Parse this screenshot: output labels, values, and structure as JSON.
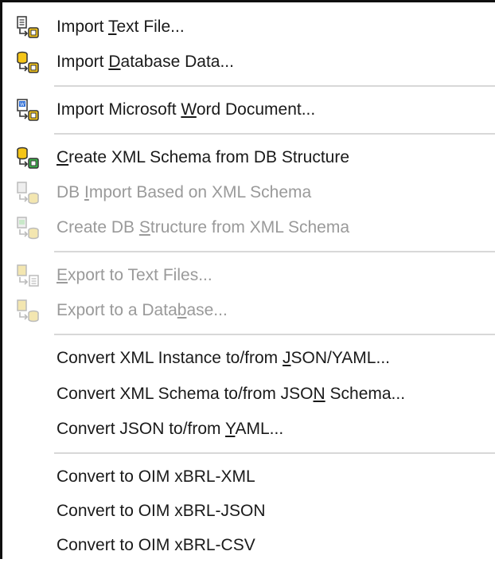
{
  "menu": {
    "items": [
      {
        "pre": "Import ",
        "key": "T",
        "post": "ext File...",
        "icon": "import-text-file-icon"
      },
      {
        "pre": "Import ",
        "key": "D",
        "post": "atabase Data...",
        "icon": "import-database-icon"
      },
      {
        "pre": "Import Microsoft ",
        "key": "W",
        "post": "ord Document...",
        "icon": "import-word-icon"
      },
      {
        "pre": "",
        "key": "C",
        "post": "reate XML Schema from DB Structure",
        "icon": "create-schema-from-db-icon"
      },
      {
        "pre": "DB ",
        "key": "I",
        "post": "mport Based on XML Schema",
        "icon": "db-import-schema-icon"
      },
      {
        "pre": "Create DB ",
        "key": "S",
        "post": "tructure from XML Schema",
        "icon": "create-db-structure-icon"
      },
      {
        "pre": "",
        "key": "E",
        "post": "xport to Text Files...",
        "icon": "export-text-icon"
      },
      {
        "pre": "Export to a Data",
        "key": "b",
        "post": "ase...",
        "icon": "export-database-icon"
      },
      {
        "pre": "Convert XML Instance to/from ",
        "key": "J",
        "post": "SON/YAML...",
        "icon": ""
      },
      {
        "pre": "Convert XML Schema to/from JSO",
        "key": "N",
        "post": " Schema...",
        "icon": ""
      },
      {
        "pre": "Convert JSON to/from ",
        "key": "Y",
        "post": "AML...",
        "icon": ""
      },
      {
        "pre": "Convert to OIM xBRL-XML",
        "key": "",
        "post": "",
        "icon": ""
      },
      {
        "pre": "Convert to OIM xBRL-JSON",
        "key": "",
        "post": "",
        "icon": ""
      },
      {
        "pre": "Convert to OIM xBRL-CSV",
        "key": "",
        "post": "",
        "icon": ""
      }
    ]
  }
}
